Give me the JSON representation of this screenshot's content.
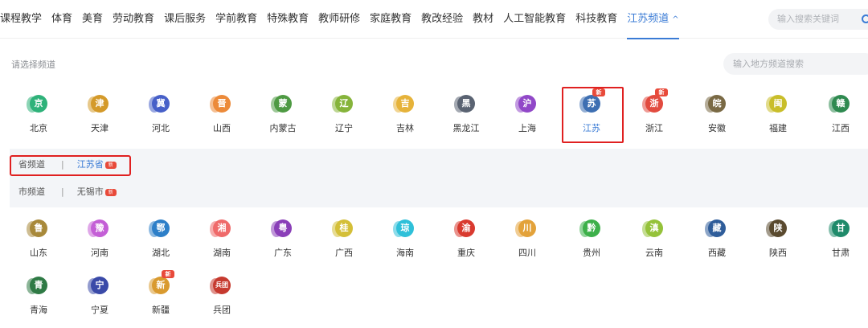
{
  "nav": {
    "items": [
      "课程教学",
      "体育",
      "美育",
      "劳动教育",
      "课后服务",
      "学前教育",
      "特殊教育",
      "教师研修",
      "家庭教育",
      "教改经验",
      "教材",
      "人工智能教育",
      "科技教育"
    ],
    "active": "江苏频道",
    "active_caret": "^",
    "search_placeholder": "输入搜索关键词"
  },
  "channels": {
    "choose_label": "请选择频道",
    "region_search_placeholder": "输入地方频道搜索",
    "new_badge": "新",
    "row1": [
      {
        "char": "京",
        "name": "北京",
        "color": "#2fb27a"
      },
      {
        "char": "津",
        "name": "天津",
        "color": "#d49a2a"
      },
      {
        "char": "冀",
        "name": "河北",
        "color": "#4760c8"
      },
      {
        "char": "晋",
        "name": "山西",
        "color": "#ec8a3a"
      },
      {
        "char": "蒙",
        "name": "内蒙古",
        "color": "#4e9a43"
      },
      {
        "char": "辽",
        "name": "辽宁",
        "color": "#86b43b"
      },
      {
        "char": "吉",
        "name": "吉林",
        "color": "#e6b33a"
      },
      {
        "char": "黑",
        "name": "黑龙江",
        "color": "#5a6372"
      },
      {
        "char": "沪",
        "name": "上海",
        "color": "#9148c8"
      },
      {
        "char": "苏",
        "name": "江苏",
        "color": "#3e6fb2"
      },
      {
        "char": "浙",
        "name": "浙江",
        "color": "#e24b3f"
      },
      {
        "char": "皖",
        "name": "安徽",
        "color": "#7a6a45"
      },
      {
        "char": "闽",
        "name": "福建",
        "color": "#c9be2a"
      },
      {
        "char": "赣",
        "name": "江西",
        "color": "#2f8a50"
      }
    ],
    "row1_new": [
      "苏",
      "浙"
    ],
    "selected": "江苏",
    "sub": {
      "province_label": "省频道",
      "province_value": "江苏省",
      "city_label": "市频道",
      "city_value": "无锡市",
      "separator": "|"
    },
    "row2": [
      {
        "char": "鲁",
        "name": "山东",
        "color": "#a8893a"
      },
      {
        "char": "豫",
        "name": "河南",
        "color": "#c45fd6"
      },
      {
        "char": "鄂",
        "name": "湖北",
        "color": "#2d7fc8"
      },
      {
        "char": "湘",
        "name": "湖南",
        "color": "#ef6a6a"
      },
      {
        "char": "粤",
        "name": "广东",
        "color": "#8a3fb8"
      },
      {
        "char": "桂",
        "name": "广西",
        "color": "#d4bf38"
      },
      {
        "char": "琼",
        "name": "海南",
        "color": "#2fc0d9"
      },
      {
        "char": "渝",
        "name": "重庆",
        "color": "#d93a2f"
      },
      {
        "char": "川",
        "name": "四川",
        "color": "#e3a23a"
      },
      {
        "char": "黔",
        "name": "贵州",
        "color": "#3db04a"
      },
      {
        "char": "滇",
        "name": "云南",
        "color": "#95c23a"
      },
      {
        "char": "藏",
        "name": "西藏",
        "color": "#2f5d9a"
      },
      {
        "char": "陕",
        "name": "陕西",
        "color": "#5a4a2f"
      },
      {
        "char": "甘",
        "name": "甘肃",
        "color": "#1f8a6a"
      }
    ],
    "row3": [
      {
        "char": "青",
        "name": "青海",
        "color": "#2f7a45"
      },
      {
        "char": "宁",
        "name": "宁夏",
        "color": "#3a4aa8"
      },
      {
        "char": "新",
        "name": "新疆",
        "color": "#d99a2f"
      },
      {
        "char": "兵团",
        "name": "兵团",
        "color": "#c63a2f"
      }
    ],
    "row3_new": [
      "新"
    ]
  }
}
